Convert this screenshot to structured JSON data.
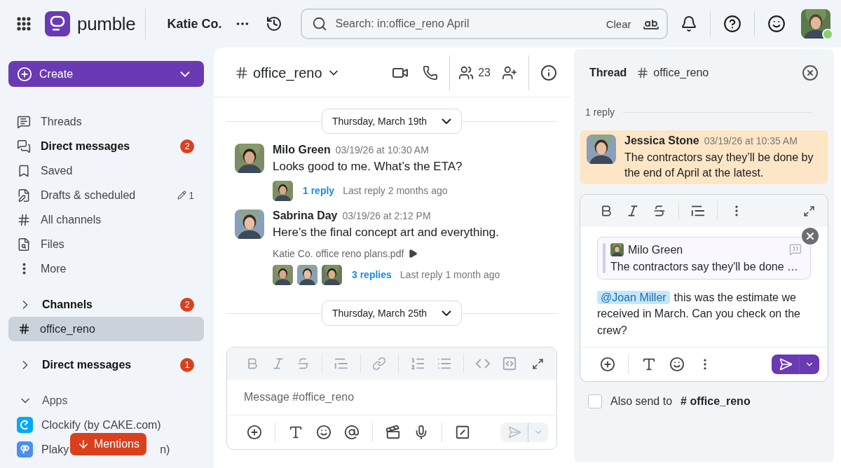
{
  "topbar": {
    "brand": "pumble",
    "workspace": "Katie Co.",
    "search": {
      "value": "Search: in:office_reno April",
      "clear": "Clear"
    }
  },
  "sidebar": {
    "create": "Create",
    "nav": [
      {
        "kind": "threads",
        "label": "Threads",
        "unread": false
      },
      {
        "kind": "dms",
        "label": "Direct messages",
        "unread": true,
        "badge": "2"
      },
      {
        "kind": "saved",
        "label": "Saved",
        "unread": false
      },
      {
        "kind": "drafts",
        "label": "Drafts & scheduled",
        "unread": false,
        "count": "1"
      },
      {
        "kind": "channels",
        "label": "All channels",
        "unread": false
      },
      {
        "kind": "files",
        "label": "Files",
        "unread": false
      },
      {
        "kind": "more",
        "label": "More",
        "unread": false
      }
    ],
    "sections": [
      {
        "kind": "channels",
        "title": "Channels",
        "expanded": false,
        "badge": "2",
        "items": [
          {
            "label": "office_reno",
            "selected": true
          }
        ]
      },
      {
        "kind": "dms",
        "title": "Direct messages",
        "expanded": false,
        "badge": "1"
      },
      {
        "kind": "apps",
        "title": "Apps",
        "expanded": true,
        "items": [
          {
            "kind": "clockify",
            "label": "Clockify (by CAKE.com)"
          },
          {
            "kind": "plaky",
            "label": "Plaky",
            "label_tail": "n)"
          }
        ]
      }
    ],
    "mentions": "Mentions"
  },
  "channel": {
    "name": "office_reno",
    "members": "23",
    "timeline": [
      {
        "kind": "date",
        "label": "Thursday, March 19th"
      },
      {
        "kind": "message",
        "author": "Milo Green",
        "time": "03/19/26 at 10:30 AM",
        "text": "Looks good to me. What’s the ETA?",
        "thread": {
          "replies": "1 reply",
          "last": "Last reply 2 months ago"
        }
      },
      {
        "kind": "message",
        "author": "Sabrina Day",
        "time": "03/19/26 at 2:12 PM",
        "text": "Here’s the final concept art and everything.",
        "attachment": "Katie Co. office reno plans.pdf",
        "thread": {
          "replies": "3 replies",
          "last": "Last reply 1 month ago"
        }
      },
      {
        "kind": "date",
        "label": "Thursday, March 25th"
      }
    ],
    "composer": {
      "placeholder": "Message #office_reno",
      "send_disabled": true
    }
  },
  "thread": {
    "title": "Thread",
    "channel": "office_reno",
    "divider": "1 reply",
    "message": {
      "author": "Jessica Stone",
      "time": "03/19/26 at 10:35 AM",
      "text": "The contractors say they’ll be done by the end of April at the latest.",
      "highlighted": true
    },
    "composer": {
      "quote": {
        "author": "Milo Green",
        "text": "The contractors say they'll be done …"
      },
      "mention": "@Joan Miller",
      "text": "this was the estimate we received in March. Can you check on the crew?",
      "send_disabled": false
    },
    "also_send": {
      "label": "Also send to",
      "channel": "# office_reno",
      "checked": false
    }
  }
}
